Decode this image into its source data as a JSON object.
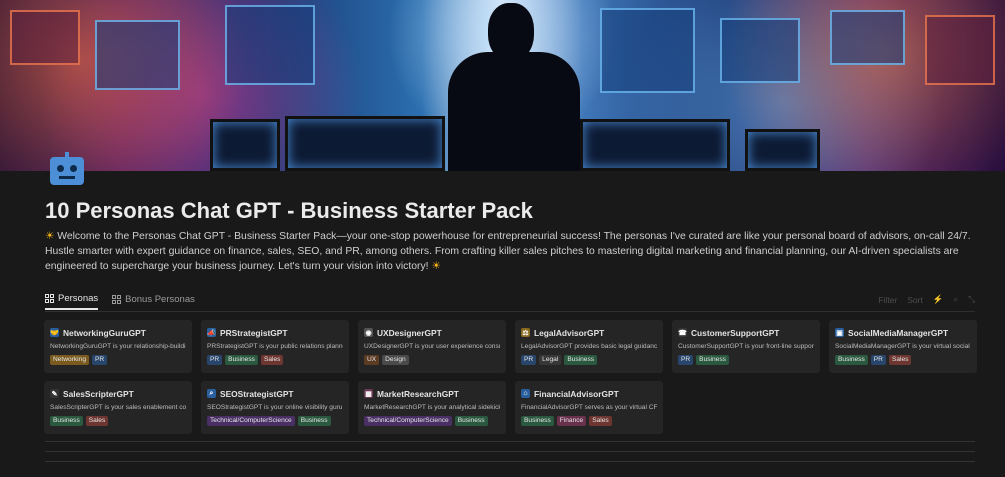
{
  "page": {
    "title": "10 Personas Chat GPT - Business Starter Pack",
    "description": "Welcome to the Personas Chat GPT - Business Starter Pack—your one-stop powerhouse for entrepreneurial success! The personas I've curated are like your personal board of advisors, on-call 24/7. Hustle smarter with expert guidance on finance, sales, SEO, and PR, among others. From crafting killer sales pitches to mastering digital marketing and financial planning, our AI-driven specialists are engineered to supercharge your business journey. Let's turn your vision into victory!",
    "icon": "robot-icon"
  },
  "tabs": [
    {
      "label": "Personas",
      "active": true
    },
    {
      "label": "Bonus Personas",
      "active": false
    }
  ],
  "toolbar": {
    "filter": "Filter",
    "sort": "Sort"
  },
  "cards": [
    {
      "name": "NetworkingGuruGPT",
      "desc": "NetworkingGuruGPT is your relationship-building",
      "tags": [
        "Networking",
        "PR"
      ],
      "icon": "handshake-icon"
    },
    {
      "name": "PRStrategistGPT",
      "desc": "PRStrategistGPT is your public relations planner, h",
      "tags": [
        "PR",
        "Business",
        "Sales"
      ],
      "icon": "megaphone-icon"
    },
    {
      "name": "UXDesignerGPT",
      "desc": "UXDesignerGPT is your user experience consultan",
      "tags": [
        "UX",
        "Design"
      ],
      "icon": "palette-icon"
    },
    {
      "name": "LegalAdvisorGPT",
      "desc": "LegalAdvisorGPT provides basic legal guidance or",
      "tags": [
        "PR",
        "Legal",
        "Business"
      ],
      "icon": "scales-icon"
    },
    {
      "name": "CustomerSupportGPT",
      "desc": "CustomerSupportGPT is your front-line support a",
      "tags": [
        "PR",
        "Business"
      ],
      "icon": "phone-icon"
    },
    {
      "name": "SocialMediaManagerGPT",
      "desc": "SocialMediaManagerGPT is your virtual social me",
      "tags": [
        "Business",
        "PR",
        "Sales"
      ],
      "icon": "phone-screen-icon"
    },
    {
      "name": "SalesScripterGPT",
      "desc": "SalesScripterGPT is your sales enablement coach,",
      "tags": [
        "Business",
        "Sales"
      ],
      "icon": "script-icon"
    },
    {
      "name": "SEOStrategistGPT",
      "desc": "SEOStrategistGPT is your online visibility guru, pro",
      "tags": [
        "Technical/ComputerScience",
        "Business"
      ],
      "icon": "magnifier-icon"
    },
    {
      "name": "MarketResearchGPT",
      "desc": "MarketResearchGPT is your analytical sidekick, he",
      "tags": [
        "Technical/ComputerScience",
        "Business"
      ],
      "icon": "chart-icon"
    },
    {
      "name": "FinancialAdvisorGPT",
      "desc": "FinancialAdvisorGPT serves as your virtual CFO, o",
      "tags": [
        "Business",
        "Finance",
        "Sales"
      ],
      "icon": "bank-icon"
    }
  ]
}
